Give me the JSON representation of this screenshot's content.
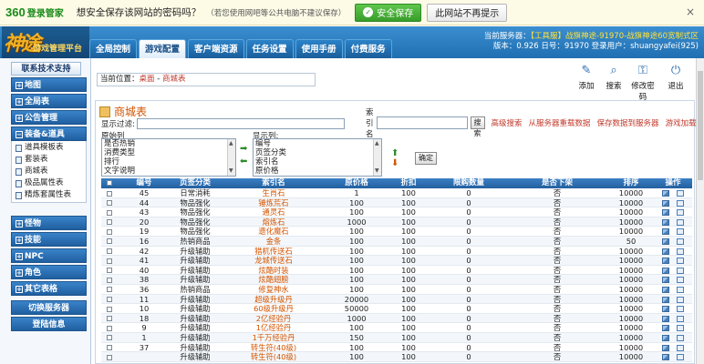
{
  "bar360": {
    "logo_num": "360",
    "logo_text": "登录管家",
    "question": "想安全保存该网站的密码吗？",
    "hint": "（若您使用网吧等公共电脑不建议保存）",
    "save_label": "安全保存",
    "never_label": "此网站不再提示",
    "close": "×"
  },
  "header": {
    "brand_big": "神途",
    "brand_small": "游戏管理平台",
    "tabs": [
      "全局控制",
      "游戏配置",
      "客户端资源",
      "任务设置",
      "使用手册",
      "付费服务"
    ],
    "active_tab": 1,
    "server_line1": "当前服务器：",
    "server_name": "【工具服】战旗神途-91970-战旗神途60宽制式区",
    "server_line2": "版本：0.926  日号：91970  登录用户：shuangyafei(925)"
  },
  "sidebar": {
    "title": "联系技术支持",
    "groups_top": [
      "地图",
      "全局表",
      "公告管理"
    ],
    "open_group": "装备&道具",
    "open_items": [
      "道具模板表",
      "套装表",
      "商城表",
      "极品属性表",
      "精炼套属性表"
    ],
    "groups_bottom": [
      "怪物",
      "技能",
      "NPC",
      "角色",
      "其它表格"
    ],
    "buttons": [
      "切换服务器",
      "登陆信息"
    ]
  },
  "toolbar": {
    "buttons": [
      {
        "label": "添加",
        "icon": "add-icon"
      },
      {
        "label": "搜索",
        "icon": "search-icon"
      },
      {
        "label": "修改密码",
        "icon": "key-icon"
      },
      {
        "label": "退出",
        "icon": "exit-icon"
      }
    ]
  },
  "breadcrumb": {
    "prefix": "当前位置：",
    "home": "桌面",
    "sep": " - ",
    "current": "商城表"
  },
  "panel": {
    "title": "商城表",
    "index_label": "索引名",
    "search_btn": "搜索",
    "link_adv": "高级搜索",
    "link_reload": "从服务器重载数据",
    "link_save": "保存数据到服务器",
    "link_load": "游戏加载生效",
    "filter_label": "显示过滤:",
    "orig_label": "原始列",
    "shown_label": "显示列:",
    "orig_items": [
      "是否热销",
      "消费类型",
      "排行",
      "文字说明"
    ],
    "shown_items": [
      "编号",
      "页签分类",
      "索引名",
      "原价格"
    ],
    "ok": "确定"
  },
  "table": {
    "headers": [
      "",
      "编号",
      "页签分类",
      "索引名",
      "原价格",
      "折扣",
      "限购数量",
      "是否下架",
      "排序",
      "操作"
    ],
    "rows": [
      [
        "45",
        "日常消耗",
        "生肖石",
        "1",
        "100",
        "0",
        "否",
        "10000"
      ],
      [
        "44",
        "物品强化",
        "锤炼荒石",
        "100",
        "100",
        "0",
        "否",
        "10000"
      ],
      [
        "43",
        "物品强化",
        "通灵石",
        "100",
        "100",
        "0",
        "否",
        "10000"
      ],
      [
        "20",
        "物品强化",
        "熔炼石",
        "1000",
        "100",
        "0",
        "否",
        "10000"
      ],
      [
        "19",
        "物品强化",
        "遗化魔石",
        "100",
        "100",
        "0",
        "否",
        "10000"
      ],
      [
        "16",
        "热销商品",
        "金条",
        "100",
        "100",
        "0",
        "否",
        "50"
      ],
      [
        "42",
        "升级辅助",
        "猎杌传送石",
        "100",
        "100",
        "0",
        "否",
        "10000"
      ],
      [
        "41",
        "升级辅助",
        "龙城传送石",
        "100",
        "100",
        "0",
        "否",
        "10000"
      ],
      [
        "40",
        "升级辅助",
        "炫酷时装",
        "100",
        "100",
        "0",
        "否",
        "10000"
      ],
      [
        "38",
        "升级辅助",
        "炫酷翅膀",
        "100",
        "100",
        "0",
        "否",
        "10000"
      ],
      [
        "36",
        "热销商品",
        "修复神水",
        "100",
        "100",
        "0",
        "否",
        "10000"
      ],
      [
        "11",
        "升级辅助",
        "超级升级丹",
        "20000",
        "100",
        "0",
        "否",
        "10000"
      ],
      [
        "10",
        "升级辅助",
        "60级升级丹",
        "50000",
        "100",
        "0",
        "否",
        "10000"
      ],
      [
        "18",
        "升级辅助",
        "2亿经验丹",
        "1000",
        "100",
        "0",
        "否",
        "10000"
      ],
      [
        "9",
        "升级辅助",
        "1亿经验丹",
        "100",
        "100",
        "0",
        "否",
        "10000"
      ],
      [
        "1",
        "升级辅助",
        "1千万经验丹",
        "150",
        "100",
        "0",
        "否",
        "10000"
      ],
      [
        "37",
        "升级辅助",
        "转生符(40级)",
        "100",
        "100",
        "0",
        "否",
        "10000"
      ],
      [
        "",
        "升级辅助",
        "转生符(40级)",
        "100",
        "100",
        "0",
        "否",
        "10000"
      ]
    ]
  }
}
